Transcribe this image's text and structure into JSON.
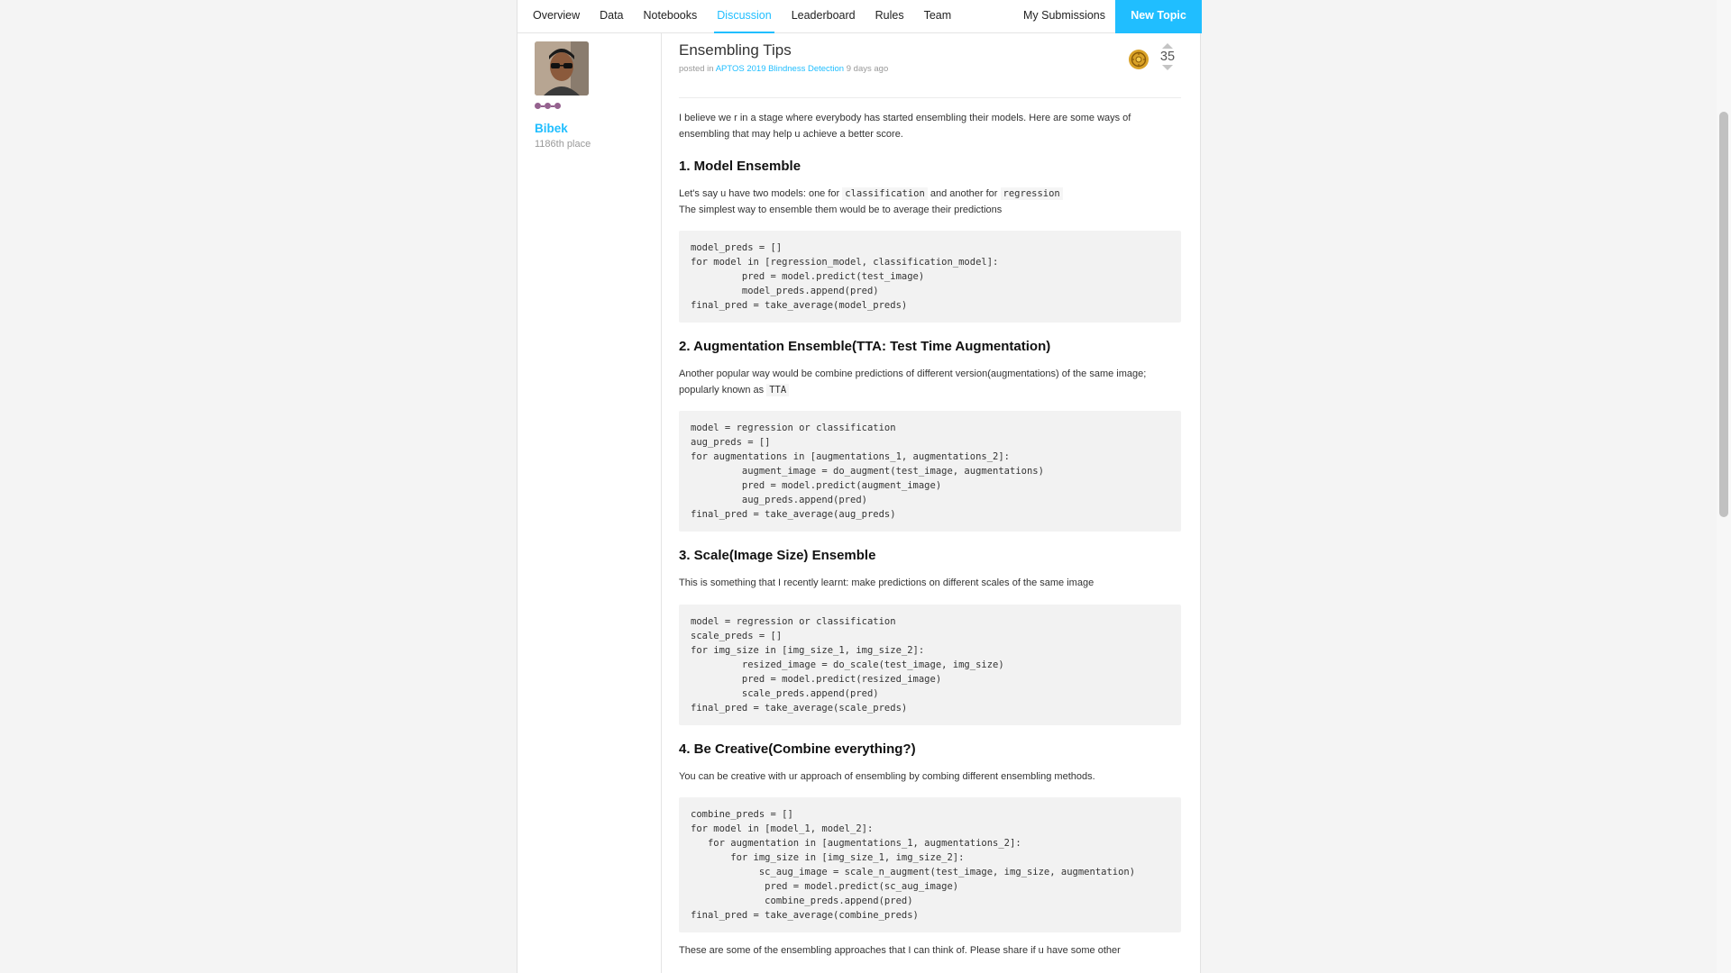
{
  "nav": {
    "links": [
      "Overview",
      "Data",
      "Notebooks",
      "Discussion",
      "Leaderboard",
      "Rules",
      "Team"
    ],
    "active": "Discussion",
    "my_submissions": "My Submissions",
    "new_topic": "New Topic"
  },
  "author": {
    "name": "Bibek",
    "rank": "1186th place",
    "tier_color": "#95628f"
  },
  "post": {
    "title": "Ensembling Tips",
    "posted_in": "posted in",
    "competition": "APTOS 2019 Blindness Detection",
    "time_ago": "9 days ago",
    "votes": "35",
    "medal": "gold-medal-icon",
    "intro": "I believe we r in a stage where everybody has started ensembling their models. Here are some ways of ensembling that may help u achieve a better score.",
    "sections": [
      {
        "heading": "1. Model Ensemble",
        "para_a": "Let's say u have two models: one for",
        "code_a": "classification",
        "para_b": "and another for",
        "code_b": "regression",
        "para_c": "The simplest way to ensemble them would be to average their predictions",
        "code": "model_preds = []\nfor model in [regression_model, classification_model]:\n         pred = model.predict(test_image)\n         model_preds.append(pred)\nfinal_pred = take_average(model_preds)"
      },
      {
        "heading": "2. Augmentation Ensemble(TTA: Test Time Augmentation)",
        "para_a": "Another popular way would be combine predictions of different version(augmentations) of the same image; popularly known as",
        "code_a": "TTA",
        "code": "model = regression or classification\naug_preds = []\nfor augmentations in [augmentations_1, augmentations_2]:\n         augment_image = do_augment(test_image, augmentations)\n         pred = model.predict(augment_image)\n         aug_preds.append(pred)\nfinal_pred = take_average(aug_preds)"
      },
      {
        "heading": "3. Scale(Image Size) Ensemble",
        "para_a": "This is something that I recently learnt: make predictions on different scales of the same image",
        "code": "model = regression or classification\nscale_preds = []\nfor img_size in [img_size_1, img_size_2]:\n         resized_image = do_scale(test_image, img_size)\n         pred = model.predict(resized_image)\n         scale_preds.append(pred)\nfinal_pred = take_average(scale_preds)"
      },
      {
        "heading": "4. Be Creative(Combine everything?)",
        "para_a": "You can be creative with ur approach of ensembling by combing different ensembling methods.",
        "code": "combine_preds = []\nfor model in [model_1, model_2]:\n   for augmentation in [augmentations_1, augmentations_2]:\n       for img_size in [img_size_1, img_size_2]:\n            sc_aug_image = scale_n_augment(test_image, img_size, augmentation)\n             pred = model.predict(sc_aug_image)\n             combine_preds.append(pred)\nfinal_pred = take_average(combine_preds)"
      }
    ],
    "outro": "These are some of the ensembling approaches that I can think of. Please share if u have some other"
  },
  "colors": {
    "accent": "#20beff",
    "code_bg": "#f2f2f2",
    "medal_gold": "#d9a227"
  }
}
